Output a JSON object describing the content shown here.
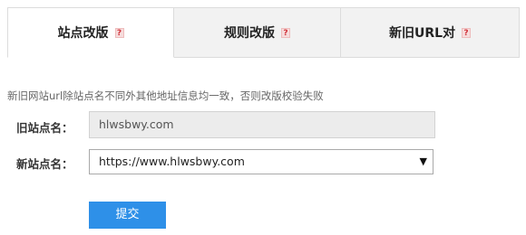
{
  "tabs": [
    {
      "label": "站点改版",
      "help": "?",
      "active": true
    },
    {
      "label": "规则改版",
      "help": "?",
      "active": false
    },
    {
      "label": "新旧URL对",
      "help": "?",
      "active": false
    }
  ],
  "notice": "新旧网站url除站点名不同外其他地址信息均一致，否则改版校验失败",
  "form": {
    "old_site_label": "旧站点名：",
    "old_site_value": "hlwsbwy.com",
    "new_site_label": "新站点名：",
    "new_site_selected": "https://www.hlwsbwy.com",
    "select_arrow": "▼",
    "submit_label": "提交"
  },
  "colors": {
    "submit_bg": "#2e90e8",
    "help_fg": "#d0323a"
  }
}
